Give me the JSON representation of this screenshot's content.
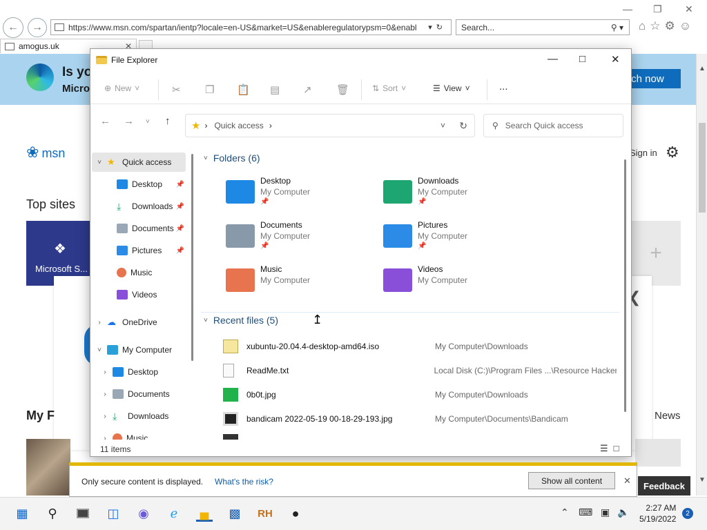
{
  "browser": {
    "url": "https://www.msn.com/spartan/ientp?locale=en-US&market=US&enableregulatorypsm=0&enabl",
    "search_placeholder": "Search...",
    "tab_title": "amogus.uk"
  },
  "msn": {
    "banner_line1": "Is yo",
    "banner_line2": "Micro",
    "banner_button": "tch now",
    "logo_text": "msn",
    "signin": "Sign in",
    "top_sites": "Top sites",
    "tile_label": "Microsoft S...",
    "my_feed": "My F",
    "news": "News",
    "feedback": "Feedback"
  },
  "explorer": {
    "title": "File Explorer",
    "toolbar": {
      "new": "New",
      "sort": "Sort",
      "view": "View",
      "more": "..."
    },
    "address": "Quick access",
    "search_placeholder": "Search Quick access",
    "nav": [
      {
        "label": "Quick access",
        "pinned": false
      },
      {
        "label": "Desktop",
        "pinned": true
      },
      {
        "label": "Downloads",
        "pinned": true
      },
      {
        "label": "Documents",
        "pinned": true
      },
      {
        "label": "Pictures",
        "pinned": true
      },
      {
        "label": "Music",
        "pinned": false
      },
      {
        "label": "Videos",
        "pinned": false
      },
      {
        "label": "OneDrive",
        "pinned": false
      },
      {
        "label": "My Computer",
        "pinned": false
      },
      {
        "label": "Desktop",
        "pinned": false
      },
      {
        "label": "Documents",
        "pinned": false
      },
      {
        "label": "Downloads",
        "pinned": false
      },
      {
        "label": "Music",
        "pinned": false
      }
    ],
    "folders_header": "Folders (6)",
    "folders": [
      {
        "name": "Desktop",
        "location": "My Computer",
        "color": "#1e88e5"
      },
      {
        "name": "Downloads",
        "location": "My Computer",
        "color": "#1ea672"
      },
      {
        "name": "Documents",
        "location": "My Computer",
        "color": "#8899aa"
      },
      {
        "name": "Pictures",
        "location": "My Computer",
        "color": "#2b8be6"
      },
      {
        "name": "Music",
        "location": "My Computer",
        "color": "#e8744f"
      },
      {
        "name": "Videos",
        "location": "My Computer",
        "color": "#8a4fd8"
      }
    ],
    "recent_header": "Recent files (5)",
    "recent": [
      {
        "name": "xubuntu-20.04.4-desktop-amd64.iso",
        "path": "My Computer\\Downloads"
      },
      {
        "name": "ReadMe.txt",
        "path": "Local Disk (C:)\\Program Files ...\\Resource Hacker"
      },
      {
        "name": "0b0t.jpg",
        "path": "My Computer\\Downloads"
      },
      {
        "name": "bandicam 2022-05-19 00-18-29-193.jpg",
        "path": "My Computer\\Documents\\Bandicam"
      }
    ],
    "status": "11 items"
  },
  "notification": {
    "message": "Only secure content is displayed.",
    "risk_link": "What's the risk?",
    "button": "Show all content"
  },
  "taskbar": {
    "time": "2:27 AM",
    "date": "5/19/2022",
    "badge": "2"
  }
}
